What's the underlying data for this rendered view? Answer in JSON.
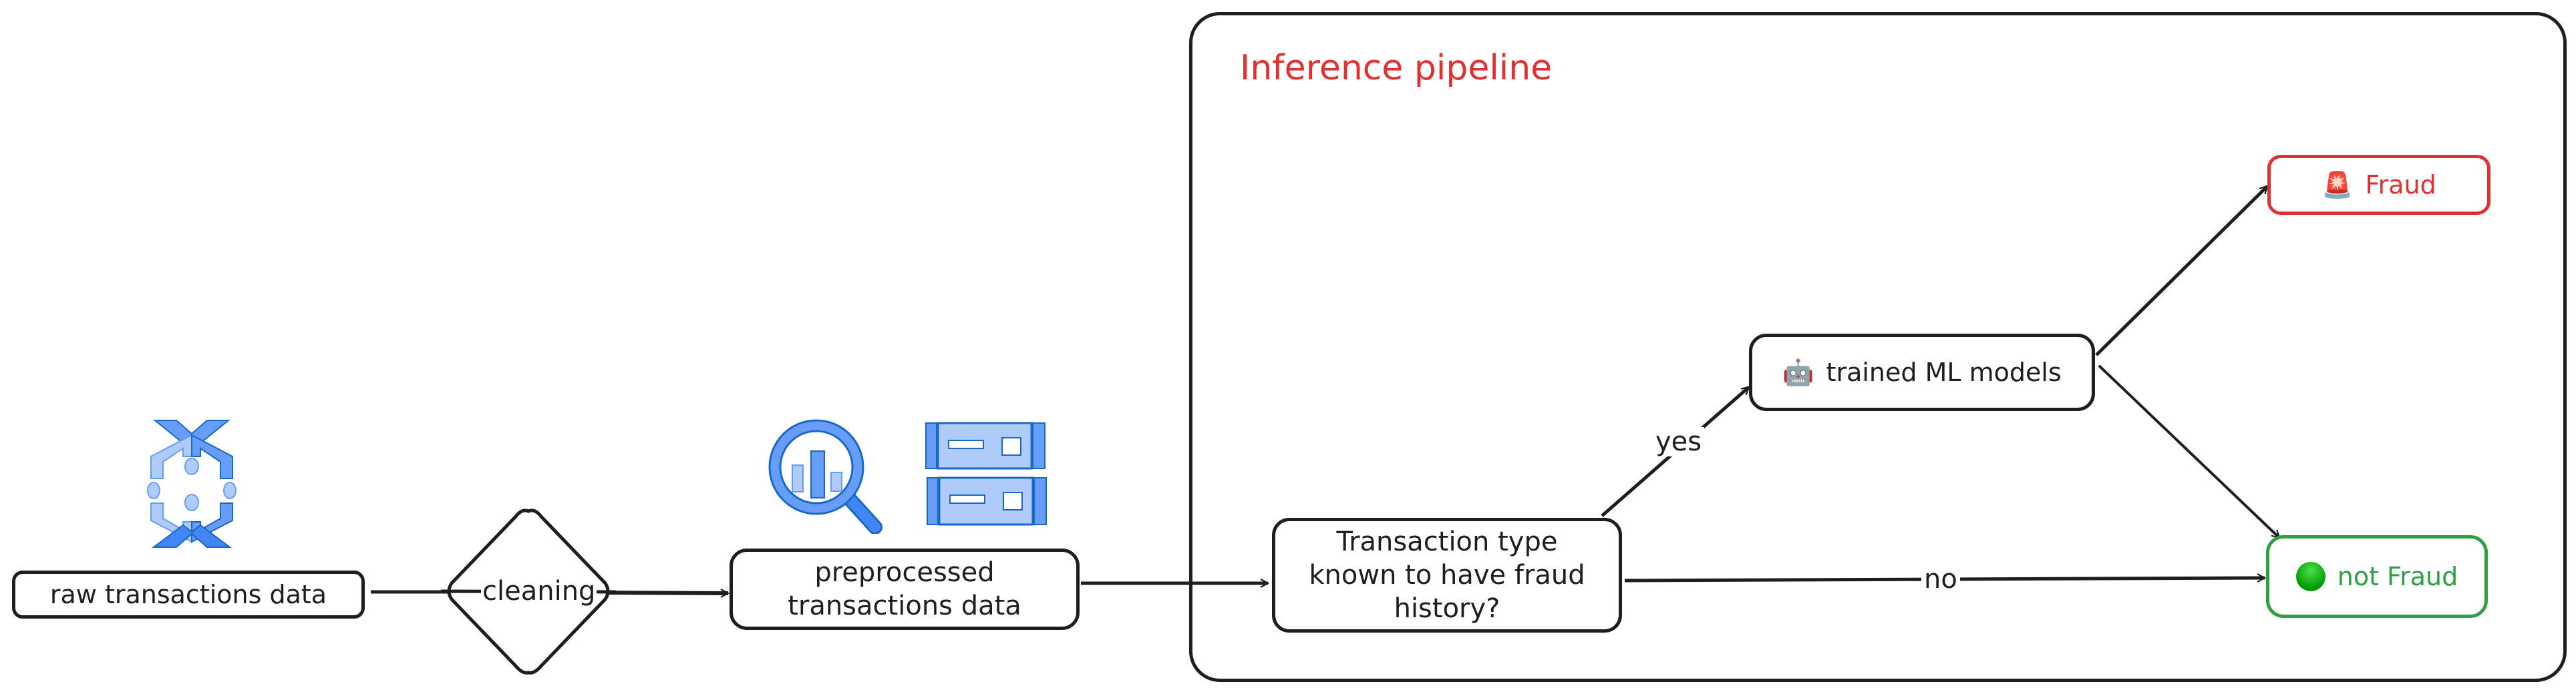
{
  "diagram": {
    "left_nodes": {
      "raw": {
        "label": "raw transactions data",
        "icon": "dataflow-icon"
      },
      "cleaning": {
        "label": "cleaning",
        "shape": "diamond"
      },
      "preprocessed": {
        "label": "preprocessed\ntransactions data",
        "icons": [
          "bigquery-icon",
          "storage-icon"
        ]
      }
    },
    "group": {
      "title": "Inference pipeline",
      "title_color": "#e03131"
    },
    "inference_nodes": {
      "question": {
        "label": "Transaction type\nknown to have fraud\nhistory?"
      },
      "model": {
        "label": "trained ML models",
        "emoji": "🤖"
      },
      "fraud": {
        "label": "Fraud",
        "emoji": "🚨",
        "color": "#e03131"
      },
      "not_fraud": {
        "label": "not Fraud",
        "emoji": "🟢",
        "color": "#2f9e44"
      }
    },
    "edges": {
      "yes": "yes",
      "no": "no"
    },
    "colors": {
      "stroke": "#1e1e1e",
      "icon_light": "#aecbfa",
      "icon_mid": "#669df6",
      "icon_dark": "#4285f4",
      "icon_outline": "#1a68c4"
    }
  }
}
